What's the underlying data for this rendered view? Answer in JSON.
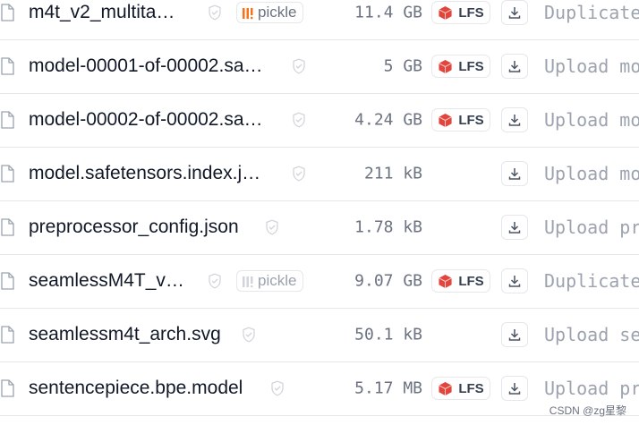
{
  "files": [
    {
      "name": "m4t_v2_multita…",
      "size": "11.4 GB",
      "lfs": true,
      "lfs_label": "LFS",
      "pickle": "active",
      "pickle_label": "pickle",
      "commit": "Duplicate"
    },
    {
      "name": "model-00001-of-00002.sa…",
      "size": "5 GB",
      "lfs": true,
      "lfs_label": "LFS",
      "pickle": null,
      "commit": "Upload mo"
    },
    {
      "name": "model-00002-of-00002.sa…",
      "size": "4.24 GB",
      "lfs": true,
      "lfs_label": "LFS",
      "pickle": null,
      "commit": "Upload mo"
    },
    {
      "name": "model.safetensors.index.j…",
      "size": "211 kB",
      "lfs": false,
      "pickle": null,
      "commit": "Upload mo"
    },
    {
      "name": "preprocessor_config.json",
      "size": "1.78 kB",
      "lfs": false,
      "pickle": null,
      "commit": "Upload pr"
    },
    {
      "name": "seamlessM4T_v…",
      "size": "9.07 GB",
      "lfs": true,
      "lfs_label": "LFS",
      "pickle": "dim",
      "pickle_label": "pickle",
      "commit": "Duplicate"
    },
    {
      "name": "seamlessm4t_arch.svg",
      "size": "50.1 kB",
      "lfs": false,
      "pickle": null,
      "commit": "Upload se"
    },
    {
      "name": "sentencepiece.bpe.model",
      "size": "5.17 MB",
      "lfs": true,
      "lfs_label": "LFS",
      "pickle": null,
      "commit": "Upload pr"
    }
  ],
  "watermark": "CSDN @zg星黎",
  "colors": {
    "lfs_cube": "#e2453c",
    "pickle_icon": "#f97316",
    "pickle_icon_dim": "#d1d5db",
    "shield": "#d1d5db"
  }
}
